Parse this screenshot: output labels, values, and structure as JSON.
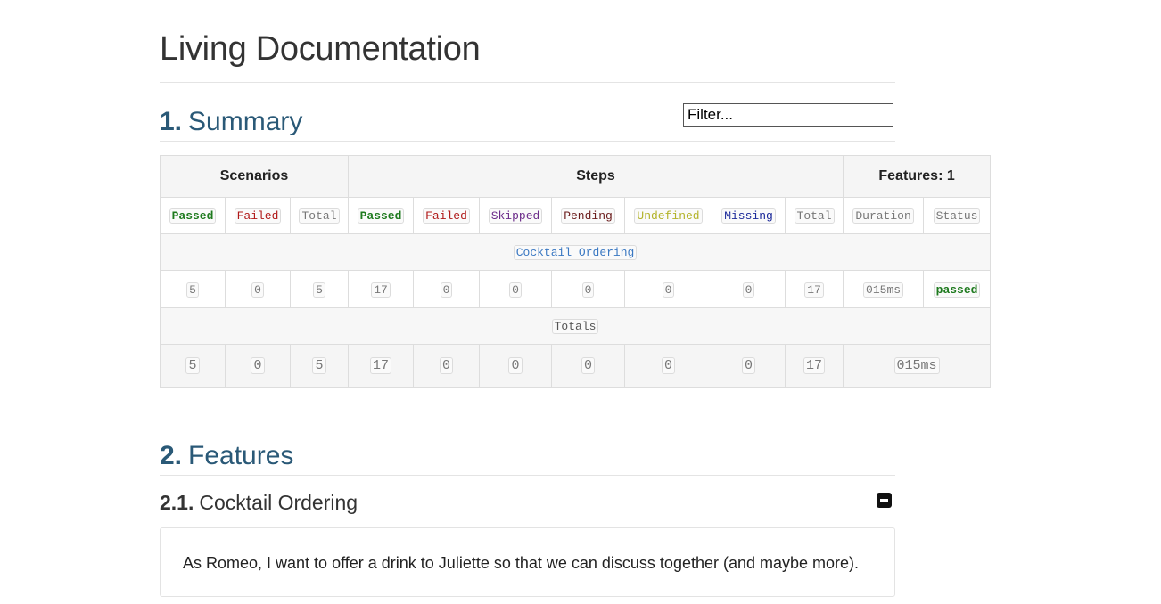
{
  "page": {
    "title": "Living Documentation"
  },
  "summary_section": {
    "number": "1.",
    "title": "Summary"
  },
  "filter": {
    "placeholder": "Filter..."
  },
  "summary_table": {
    "groups": {
      "scenarios": "Scenarios",
      "steps": "Steps",
      "features": "Features: 1"
    },
    "columns": {
      "scen_passed": "Passed",
      "scen_failed": "Failed",
      "scen_total": "Total",
      "step_passed": "Passed",
      "step_failed": "Failed",
      "step_skipped": "Skipped",
      "step_pending": "Pending",
      "step_undefined": "Undefined",
      "step_missing": "Missing",
      "step_total": "Total",
      "duration": "Duration",
      "status": "Status"
    },
    "feature_row": {
      "name": "Cocktail Ordering",
      "scen_passed": "5",
      "scen_failed": "0",
      "scen_total": "5",
      "step_passed": "17",
      "step_failed": "0",
      "step_skipped": "0",
      "step_pending": "0",
      "step_undefined": "0",
      "step_missing": "0",
      "step_total": "17",
      "duration": "015ms",
      "status": "passed"
    },
    "totals_label": "Totals",
    "totals_row": {
      "scen_passed": "5",
      "scen_failed": "0",
      "scen_total": "5",
      "step_passed": "17",
      "step_failed": "0",
      "step_skipped": "0",
      "step_pending": "0",
      "step_undefined": "0",
      "step_missing": "0",
      "step_total": "17",
      "duration": "015ms"
    }
  },
  "features_section": {
    "number": "2.",
    "title": "Features"
  },
  "feature": {
    "number": "2.1.",
    "title": "Cocktail Ordering",
    "description": "As Romeo, I want to offer a drink to Juliette so that we can discuss together (and maybe more)."
  }
}
